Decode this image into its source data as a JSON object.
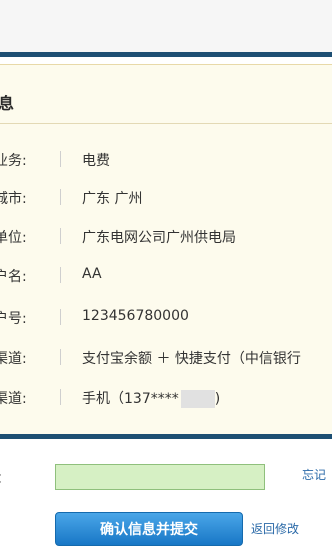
{
  "panel": {
    "title": "息",
    "rows": [
      {
        "label": "业务:",
        "value": "电费"
      },
      {
        "label": "城市:",
        "value": "广东 广州"
      },
      {
        "label": "单位:",
        "value": "广东电网公司广州供电局"
      },
      {
        "label": "户名:",
        "value": "AA"
      },
      {
        "label": "户号:",
        "value": "123456780000"
      },
      {
        "label": "渠道:",
        "value": "支付宝余额 ＋ 快捷支付（中信银行"
      },
      {
        "label": "渠道:",
        "value": "手机（137****",
        "suffix": ")"
      }
    ]
  },
  "form": {
    "password_label": "：",
    "forgot_link": "忘记"
  },
  "actions": {
    "submit_label": "确认信息并提交",
    "back_label": "返回修改"
  },
  "colors": {
    "accent_bar": "#1d4f73",
    "panel_bg": "#fdfbed",
    "input_bg": "#d6f0c4",
    "button": "#1877c6",
    "link": "#2b6aa8"
  }
}
